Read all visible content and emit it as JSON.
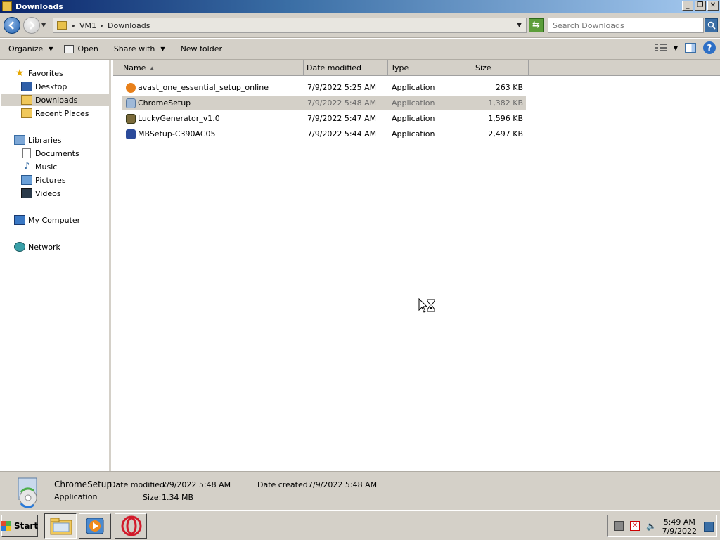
{
  "window": {
    "title": "Downloads"
  },
  "address": {
    "crumbs": [
      "VM1",
      "Downloads"
    ],
    "search_placeholder": "Search Downloads"
  },
  "toolbar": {
    "organize": "Organize",
    "open": "Open",
    "share_with": "Share with",
    "new_folder": "New folder"
  },
  "nav": {
    "favorites": "Favorites",
    "desktop": "Desktop",
    "downloads": "Downloads",
    "recent_places": "Recent Places",
    "libraries": "Libraries",
    "documents": "Documents",
    "music": "Music",
    "pictures": "Pictures",
    "videos": "Videos",
    "my_computer": "My Computer",
    "network": "Network"
  },
  "columns": {
    "name": "Name",
    "date_modified": "Date modified",
    "type": "Type",
    "size": "Size"
  },
  "files": [
    {
      "name": "avast_one_essential_setup_online",
      "date": "7/9/2022 5:25 AM",
      "type": "Application",
      "size": "263 KB",
      "icon_color": "#e8801a"
    },
    {
      "name": "ChromeSetup",
      "date": "7/9/2022 5:48 AM",
      "type": "Application",
      "size": "1,382 KB",
      "icon_color": "#9fb9d8"
    },
    {
      "name": "LuckyGenerator_v1.0",
      "date": "7/9/2022 5:47 AM",
      "type": "Application",
      "size": "1,596 KB",
      "icon_color": "#7a6a3a"
    },
    {
      "name": "MBSetup-C390AC05",
      "date": "7/9/2022 5:44 AM",
      "type": "Application",
      "size": "2,497 KB",
      "icon_color": "#2a4a9a"
    }
  ],
  "details": {
    "name": "ChromeSetup",
    "type": "Application",
    "date_modified_label": "Date modified:",
    "date_modified": "7/9/2022 5:48 AM",
    "size_label": "Size:",
    "size": "1.34 MB",
    "date_created_label": "Date created:",
    "date_created": "7/9/2022 5:48 AM"
  },
  "taskbar": {
    "start": "Start",
    "time": "5:49 AM",
    "date": "7/9/2022"
  },
  "colors": {
    "title_start": "#0a246a",
    "title_end": "#a6caf0",
    "chrome": "#d4d0c8",
    "selected_row": "#d4d0c8"
  }
}
